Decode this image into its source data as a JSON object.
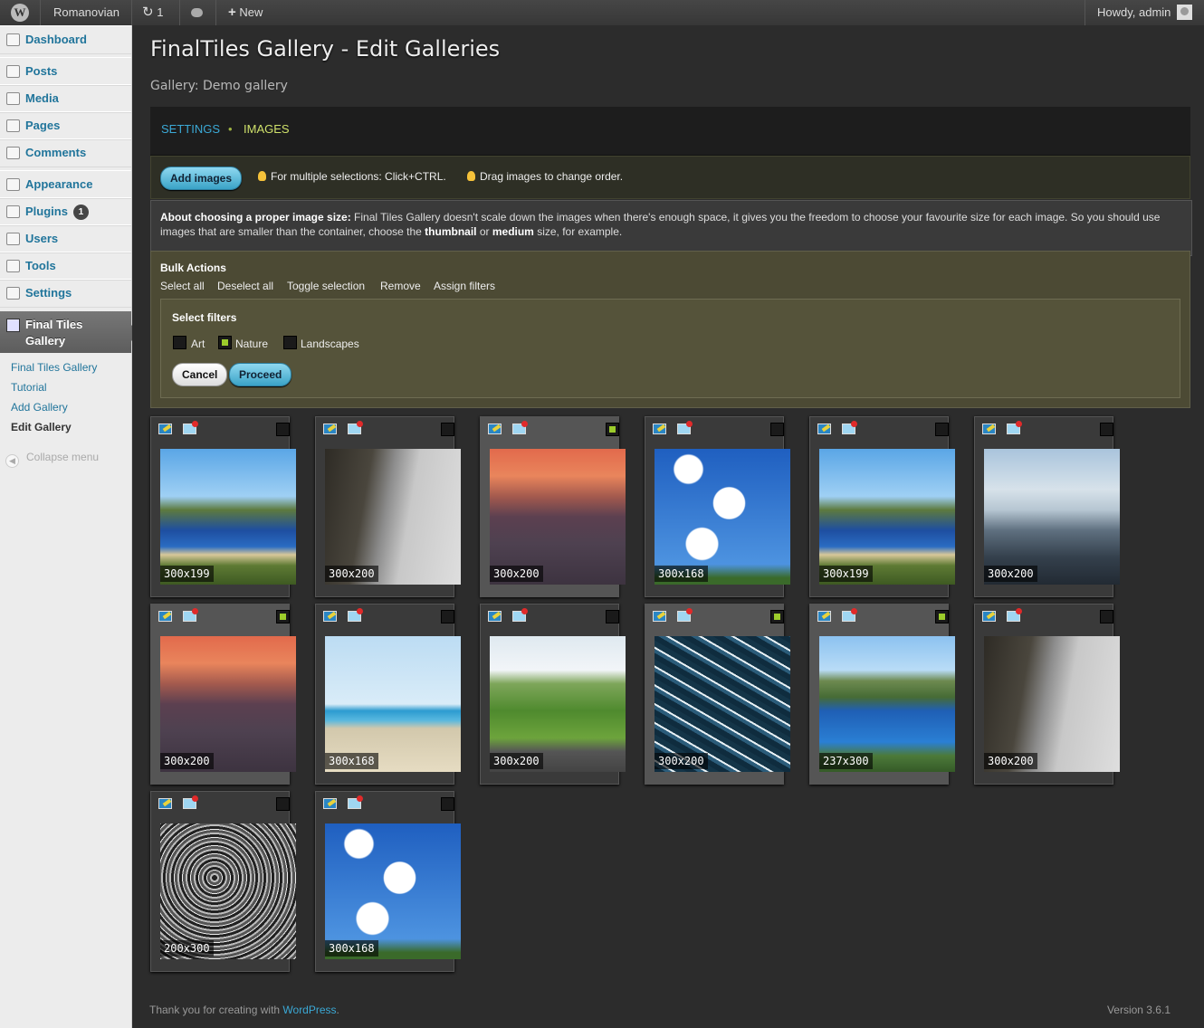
{
  "adminbar": {
    "site_name": "Romanovian",
    "updates_count": "1",
    "new_label": "New",
    "greeting": "Howdy, admin"
  },
  "sidebar": {
    "items": [
      {
        "label": "Dashboard",
        "icon": "home-icon"
      },
      {
        "label": "Posts",
        "icon": "pin-icon"
      },
      {
        "label": "Media",
        "icon": "media-icon"
      },
      {
        "label": "Pages",
        "icon": "pages-icon"
      },
      {
        "label": "Comments",
        "icon": "comment-icon"
      },
      {
        "label": "Appearance",
        "icon": "appearance-icon"
      },
      {
        "label": "Plugins",
        "icon": "plugin-icon",
        "badge": "1"
      },
      {
        "label": "Users",
        "icon": "users-icon"
      },
      {
        "label": "Tools",
        "icon": "tools-icon"
      },
      {
        "label": "Settings",
        "icon": "settings-icon"
      }
    ],
    "current": {
      "line1": "Final Tiles",
      "line2": "Gallery"
    },
    "submenu": [
      "Final Tiles Gallery",
      "Tutorial",
      "Add Gallery",
      "Edit Gallery"
    ],
    "collapse": "Collapse menu"
  },
  "page": {
    "title": "FinalTiles Gallery - Edit Galleries",
    "subtitle": "Gallery: Demo gallery",
    "tabs": [
      "SETTINGS",
      "IMAGES"
    ],
    "add_images": "Add images",
    "tip1": "For multiple selections: Click+CTRL.",
    "tip2": "Drag images to change order.",
    "info_bold": "About choosing a proper image size:",
    "info_text1": " Final Tiles Gallery doesn't scale down the images when there's enough space, it gives you the freedom to choose your favourite size for each image. So you should use images that are smaller than the container, choose the ",
    "info_thumb": "thumbnail",
    "info_or": " or ",
    "info_medium": "medium",
    "info_text2": " size, for example."
  },
  "bulk": {
    "title": "Bulk Actions",
    "actions": [
      "Select all",
      "Deselect all",
      "Toggle selection",
      "Remove",
      "Assign filters"
    ],
    "filters_title": "Select filters",
    "filters": [
      {
        "label": "Art",
        "checked": false
      },
      {
        "label": "Nature",
        "checked": true
      },
      {
        "label": "Landscapes",
        "checked": false
      }
    ],
    "cancel": "Cancel",
    "proceed": "Proceed"
  },
  "images": [
    {
      "size": "300x199",
      "selected": false,
      "scene": "bay"
    },
    {
      "size": "300x200",
      "selected": false,
      "scene": "fog"
    },
    {
      "size": "300x200",
      "selected": true,
      "scene": "sunset"
    },
    {
      "size": "300x168",
      "selected": false,
      "scene": "clouds"
    },
    {
      "size": "300x199",
      "selected": false,
      "scene": "bay"
    },
    {
      "size": "300x200",
      "selected": false,
      "scene": "sea"
    },
    {
      "size": "300x200",
      "selected": true,
      "scene": "sunset"
    },
    {
      "size": "300x168",
      "selected": false,
      "scene": "beach"
    },
    {
      "size": "300x200",
      "selected": false,
      "scene": "scooter"
    },
    {
      "size": "300x200",
      "selected": true,
      "scene": "water"
    },
    {
      "size": "237x300",
      "selected": true,
      "scene": "bay2"
    },
    {
      "size": "300x200",
      "selected": false,
      "scene": "fog"
    },
    {
      "size": "200x300",
      "selected": false,
      "scene": "texture"
    },
    {
      "size": "300x168",
      "selected": false,
      "scene": "clouds"
    }
  ],
  "footer": {
    "thanks": "Thank you for creating with ",
    "wordpress": "WordPress",
    "dot": ".",
    "version": "Version 3.6.1"
  }
}
